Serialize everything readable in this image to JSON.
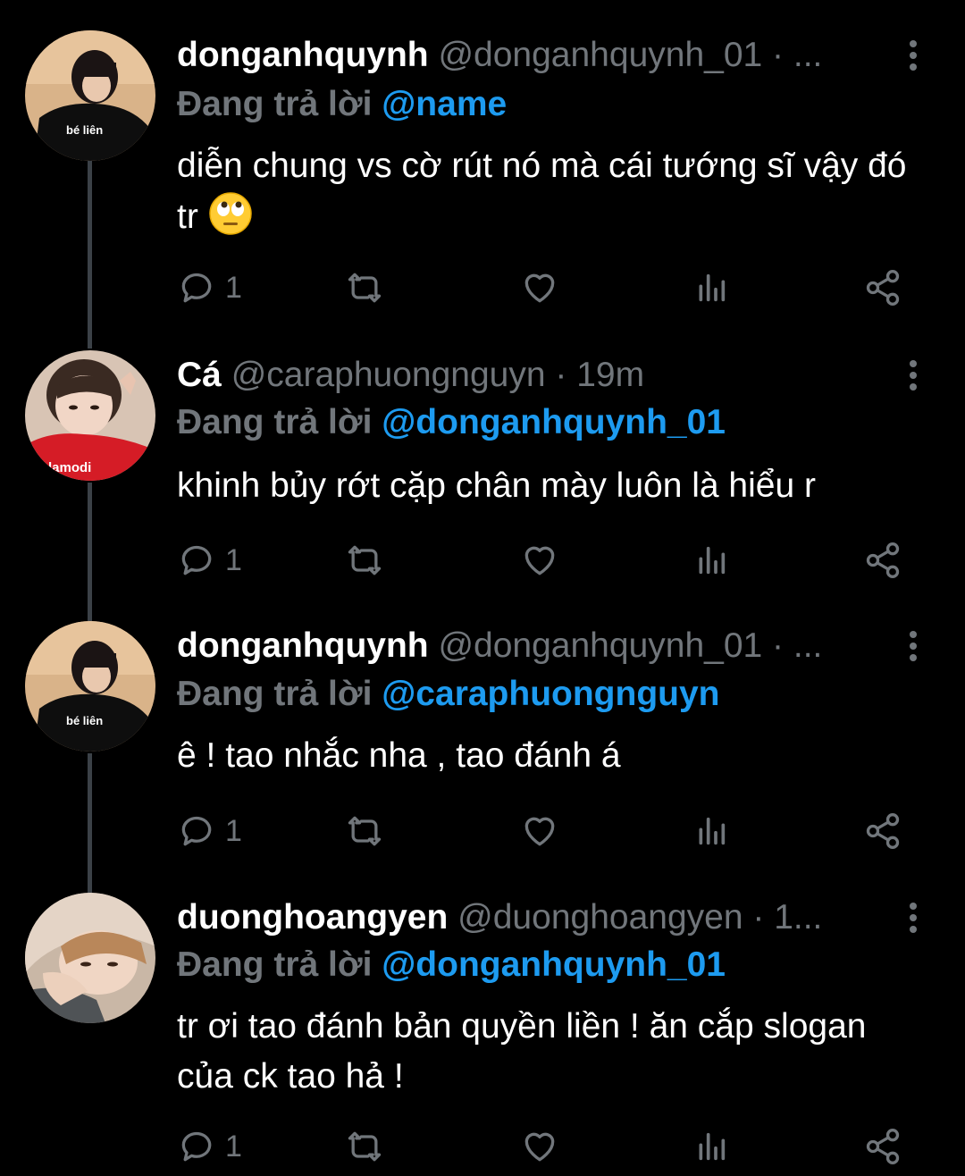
{
  "colors": {
    "background": "#000000",
    "text_primary": "#ffffff",
    "text_secondary": "#71767b",
    "accent": "#1d9bf0",
    "thread_line": "#3b4147"
  },
  "reply_prefix": "Đang trả lời",
  "icons": {
    "reply": "reply-bubble-icon",
    "retweet": "retweet-icon",
    "like": "heart-icon",
    "views": "analytics-bars-icon",
    "share": "share-icon",
    "more": "more-vertical-icon"
  },
  "tweets": [
    {
      "display_name": "donganhquynh",
      "handle": "@donganhquynh_01",
      "time": "· ...",
      "reply_to": "@name",
      "text": "diễn chung vs cờ rút nó mà cái tướng sĩ vậy đó tr",
      "emoji": "face-with-rolling-eyes",
      "reply_count": "1"
    },
    {
      "display_name": "Cá",
      "handle": "@caraphuongnguyn",
      "time": "· 19m",
      "reply_to": "@donganhquynh_01",
      "text": "khinh bủy rớt cặp chân mày luôn là hiểu r",
      "reply_count": "1"
    },
    {
      "display_name": "donganhquynh",
      "handle": "@donganhquynh_01",
      "time": "· ...",
      "reply_to": "@caraphuongnguyn",
      "text": "ê ! tao nhắc nha , tao đánh á",
      "reply_count": "1"
    },
    {
      "display_name": "duonghoangyen",
      "handle": "@duonghoangyen",
      "time": "· 1...",
      "reply_to": "@donganhquynh_01",
      "text": "tr ơi tao đánh bản quyền liền ! ăn cắp slogan của ck tao hả !",
      "reply_count": "1"
    }
  ]
}
